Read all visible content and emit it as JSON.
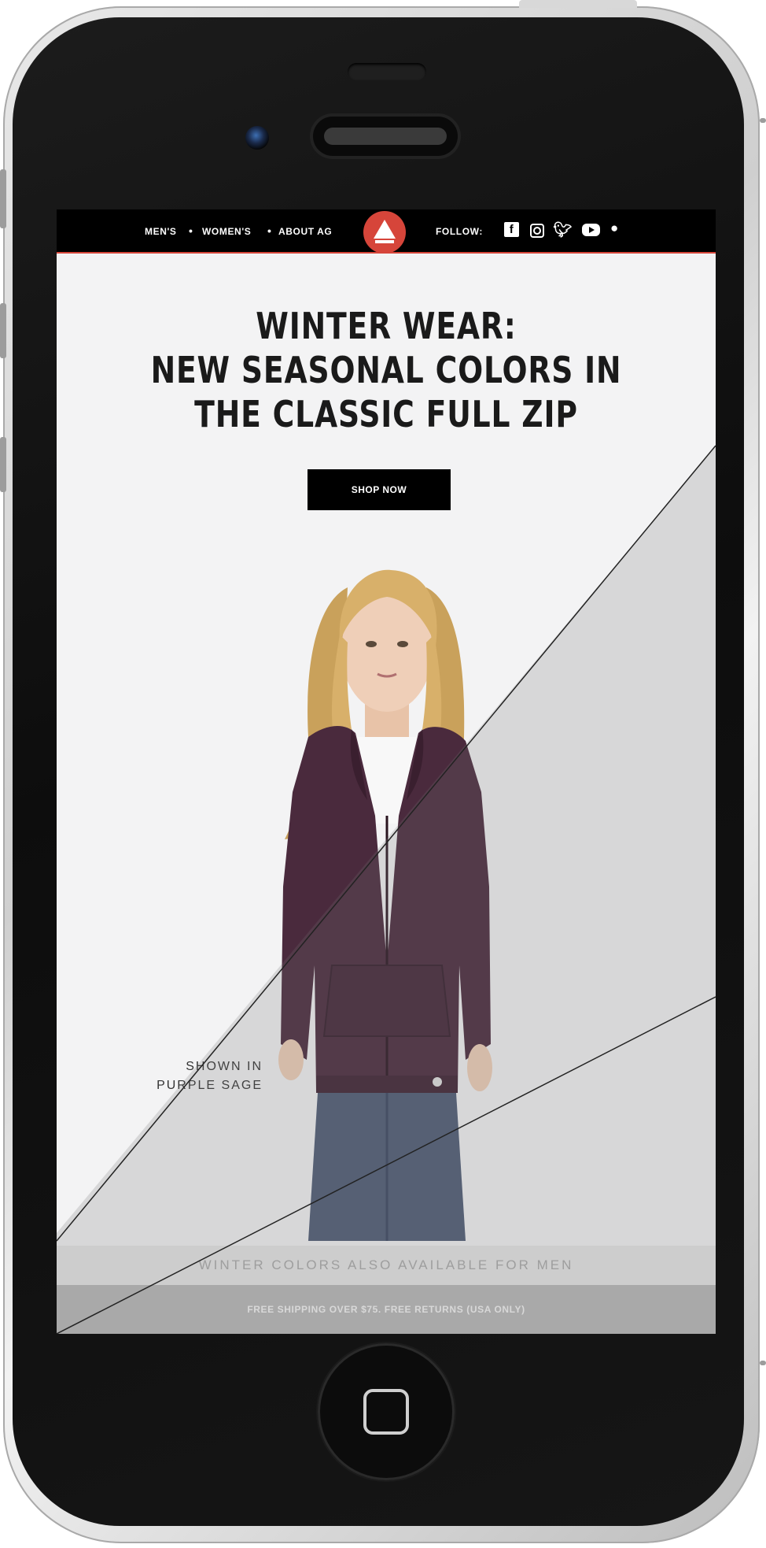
{
  "nav": {
    "mens": "MEN'S",
    "separator": "•",
    "womens": "WOMEN'S",
    "about": "ABOUT AG",
    "follow": "FOLLOW:",
    "social_icons": [
      "facebook-icon",
      "instagram-icon",
      "twitter-icon",
      "youtube-icon",
      "more-icon"
    ],
    "accent_color": "#d6453a"
  },
  "hero": {
    "headline_line1": "WINTER WEAR:",
    "headline_line2": "NEW SEASONAL COLORS IN",
    "headline_line3": "THE CLASSIC FULL ZIP",
    "cta": "SHOP NOW"
  },
  "product": {
    "shown_in_line1": "SHOWN IN",
    "shown_in_line2": "PURPLE SAGE",
    "hoodie_color": "#4a2a3d"
  },
  "footer": {
    "men_link": "WINTER COLORS ALSO AVAILABLE FOR MEN",
    "shipping": "FREE SHIPPING OVER $75. FREE RETURNS (USA ONLY)"
  }
}
